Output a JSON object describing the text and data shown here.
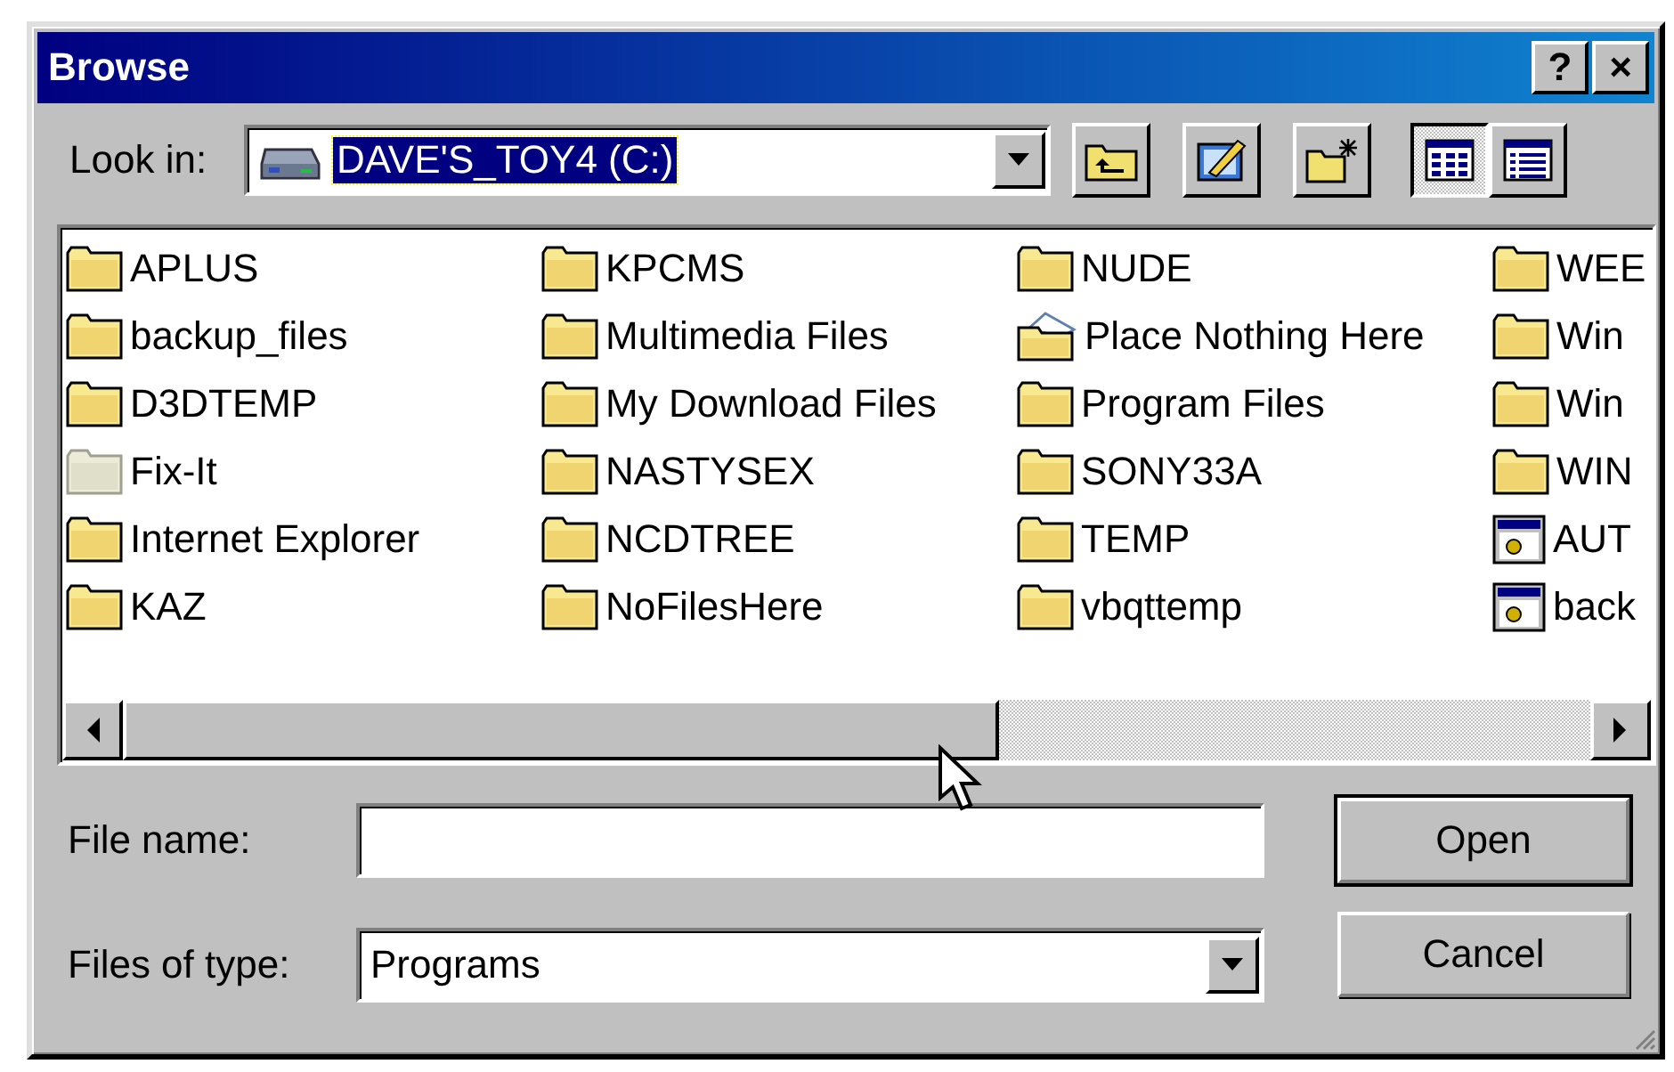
{
  "window": {
    "title": "Browse",
    "buttons": [
      "?",
      "×"
    ]
  },
  "look_in": {
    "label": "Look in:",
    "value": "DAVE'S_TOY4 (C:)"
  },
  "toolbar": [
    {
      "kind": "up",
      "selected": false
    },
    {
      "kind": "desktop",
      "selected": false
    },
    {
      "kind": "new-folder",
      "selected": false
    },
    {
      "kind": "list",
      "selected": true
    },
    {
      "kind": "details",
      "selected": false
    }
  ],
  "items": [
    {
      "name": "APLUS",
      "kind": "folder"
    },
    {
      "name": "backup_files",
      "kind": "folder"
    },
    {
      "name": "D3DTEMP",
      "kind": "folder"
    },
    {
      "name": "Fix-It",
      "kind": "hidden-folder"
    },
    {
      "name": "Internet Explorer",
      "kind": "folder"
    },
    {
      "name": "KAZ",
      "kind": "folder"
    },
    {
      "name": "KPCMS",
      "kind": "folder"
    },
    {
      "name": "Multimedia Files",
      "kind": "folder"
    },
    {
      "name": "My Download Files",
      "kind": "folder"
    },
    {
      "name": "NASTYSEX",
      "kind": "folder"
    },
    {
      "name": "NCDTREE",
      "kind": "folder"
    },
    {
      "name": "NoFilesHere",
      "kind": "folder"
    },
    {
      "name": "NUDE",
      "kind": "folder"
    },
    {
      "name": "Place Nothing Here",
      "kind": "web-folder"
    },
    {
      "name": "Program Files",
      "kind": "folder"
    },
    {
      "name": "SONY33A",
      "kind": "folder"
    },
    {
      "name": "TEMP",
      "kind": "folder"
    },
    {
      "name": "vbqttemp",
      "kind": "folder"
    },
    {
      "name": "WEE",
      "kind": "folder"
    },
    {
      "name": "Win",
      "kind": "folder"
    },
    {
      "name": "Win",
      "kind": "folder"
    },
    {
      "name": "WIN",
      "kind": "folder"
    },
    {
      "name": "AUT",
      "kind": "program"
    },
    {
      "name": "back",
      "kind": "program"
    }
  ],
  "file_name": {
    "label": "File name:"
  },
  "file_type": {
    "label": "Files of type:",
    "value": "Programs"
  },
  "buttons": [
    {
      "label": "Open",
      "default": true
    },
    {
      "label": "Cancel",
      "default": false
    }
  ]
}
